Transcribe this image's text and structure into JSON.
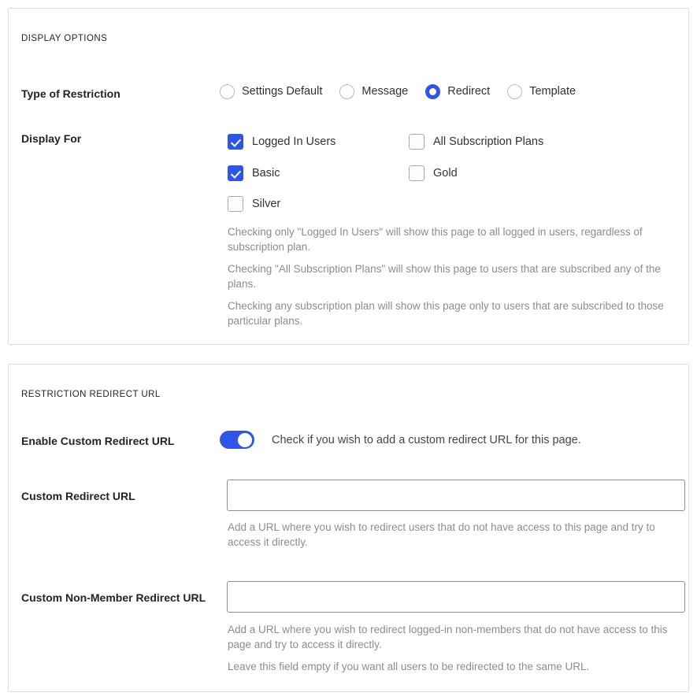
{
  "display_options": {
    "section_title": "DISPLAY OPTIONS",
    "type_of_restriction": {
      "label": "Type of Restriction",
      "selected": "Redirect",
      "options": [
        {
          "label": "Settings Default",
          "checked": false
        },
        {
          "label": "Message",
          "checked": false
        },
        {
          "label": "Redirect",
          "checked": true
        },
        {
          "label": "Template",
          "checked": false
        }
      ]
    },
    "display_for": {
      "label": "Display For",
      "options": [
        {
          "label": "Logged In Users",
          "checked": true
        },
        {
          "label": "All Subscription Plans",
          "checked": false
        },
        {
          "label": "Basic",
          "checked": true
        },
        {
          "label": "Gold",
          "checked": false
        },
        {
          "label": "Silver",
          "checked": false
        }
      ],
      "help": [
        "Checking only \"Logged In Users\" will show this page to all logged in users, regardless of subscription plan.",
        "Checking \"All Subscription Plans\" will show this page to users that are subscribed any of the plans.",
        "Checking any subscription plan will show this page only to users that are subscribed to those particular plans."
      ]
    }
  },
  "restriction_redirect_url": {
    "section_title": "RESTRICTION REDIRECT URL",
    "enable_custom_redirect": {
      "label": "Enable Custom Redirect URL",
      "enabled": true,
      "note": "Check if you wish to add a custom redirect URL for this page."
    },
    "custom_redirect_url": {
      "label": "Custom Redirect URL",
      "value": "",
      "placeholder": "",
      "help": "Add a URL where you wish to redirect users that do not have access to this page and try to access it directly."
    },
    "custom_non_member_redirect_url": {
      "label": "Custom Non-Member Redirect URL",
      "value": "",
      "placeholder": "",
      "help": [
        "Add a URL where you wish to redirect logged-in non-members that do not have access to this page and try to access it directly.",
        "Leave this field empty if you want all users to be redirected to the same URL."
      ]
    }
  },
  "colors": {
    "accent": "#2e54e8",
    "text": "#1d2327",
    "muted": "#8a8d91",
    "border": "#dcdcde",
    "input_border": "#8c8f94"
  }
}
